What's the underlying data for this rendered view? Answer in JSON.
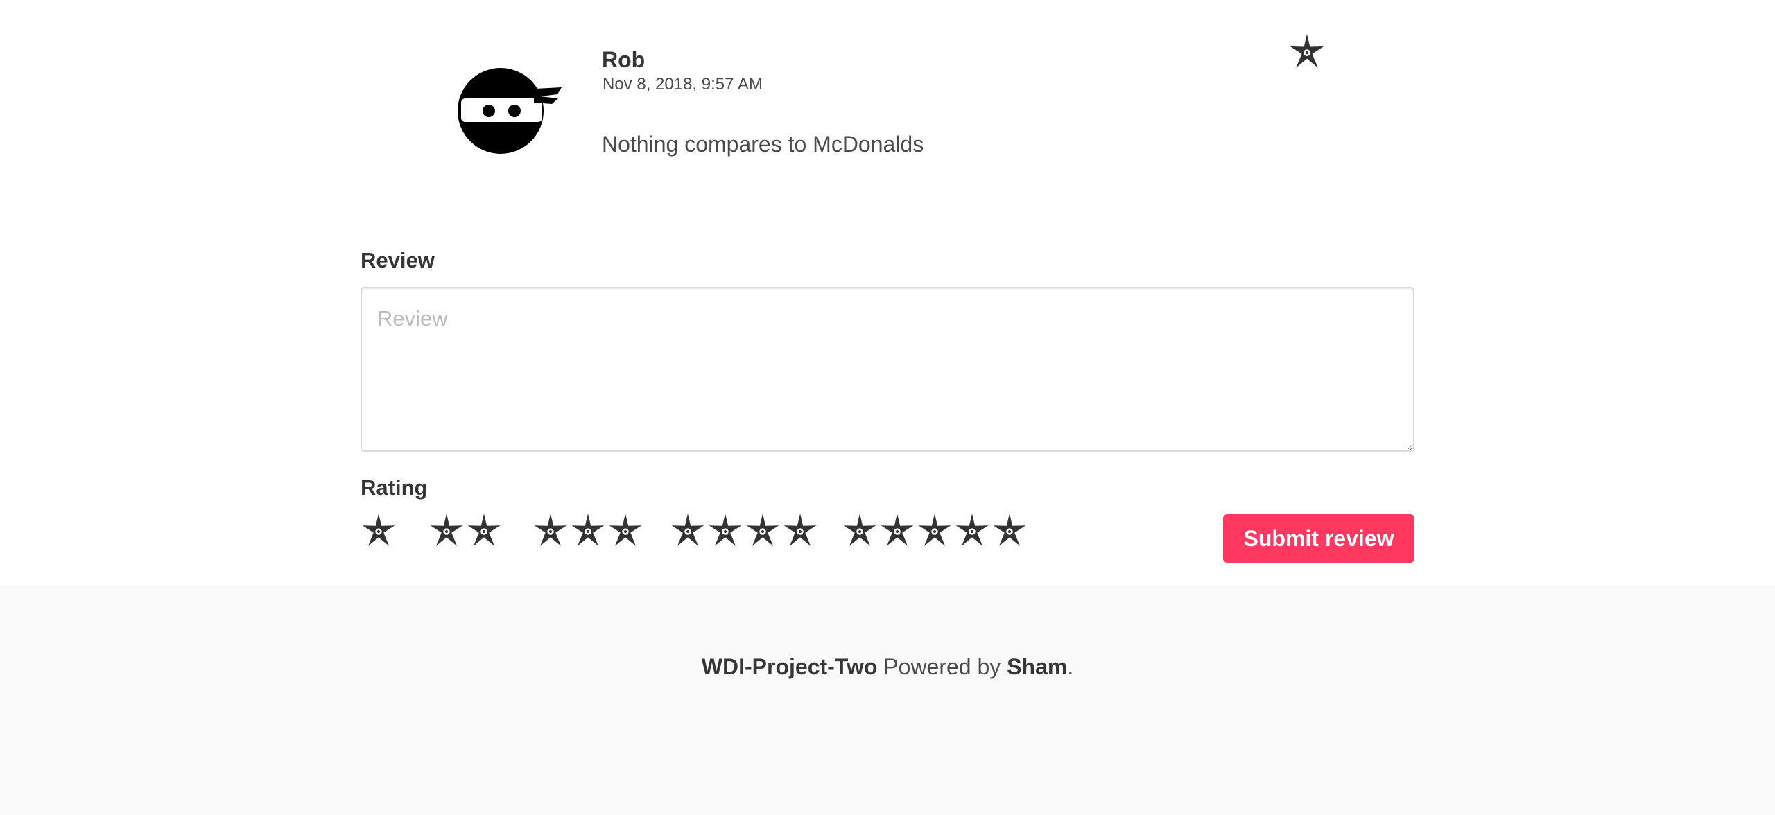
{
  "review": {
    "author": "Rob",
    "date": "Nov 8, 2018, 9:57 AM",
    "text": "Nothing compares to McDonalds",
    "rating": 1,
    "avatar_icon": "ninja-avatar-icon",
    "rating_icon": "shuriken-star-icon"
  },
  "form": {
    "review_label": "Review",
    "review_placeholder": "Review",
    "review_value": "",
    "rating_label": "Rating",
    "rating_options": [
      1,
      2,
      3,
      4,
      5
    ],
    "submit_label": "Submit review"
  },
  "footer": {
    "project": "WDI-Project-Two",
    "powered_by": "Powered by",
    "author": "Sham",
    "period": "."
  },
  "colors": {
    "accent": "#ff3860",
    "text": "#363636",
    "footer_bg": "#fafafa",
    "star": "#333333"
  }
}
